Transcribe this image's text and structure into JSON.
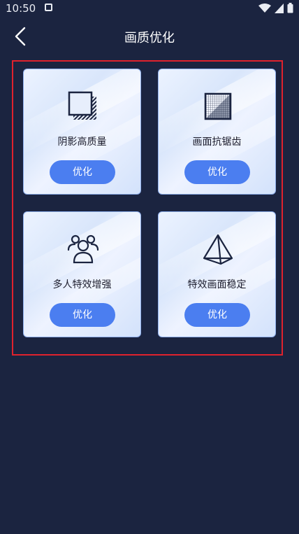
{
  "status_bar": {
    "time": "10:50"
  },
  "header": {
    "title": "画质优化"
  },
  "cards": [
    {
      "label": "阴影高质量",
      "button": "优化",
      "icon": "shadow-square-icon"
    },
    {
      "label": "画面抗锯齿",
      "button": "优化",
      "icon": "grid-square-icon"
    },
    {
      "label": "多人特效增强",
      "button": "优化",
      "icon": "people-group-icon"
    },
    {
      "label": "特效画面稳定",
      "button": "优化",
      "icon": "pyramid-icon"
    }
  ],
  "colors": {
    "background": "#1b2440",
    "accent": "#4b7ef0",
    "highlight_frame": "#e0222d"
  }
}
